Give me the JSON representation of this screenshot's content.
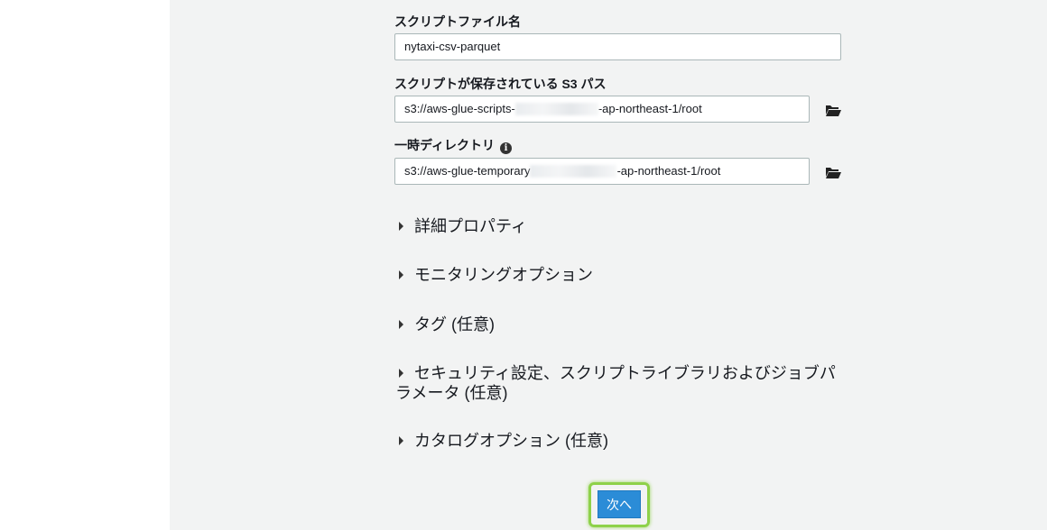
{
  "form": {
    "script_filename": {
      "label": "スクリプトファイル名",
      "value": "nytaxi-csv-parquet"
    },
    "script_s3_path": {
      "label": "スクリプトが保存されている S3 パス",
      "value_prefix": "s3://aws-glue-scripts-",
      "value_suffix": "-ap-northeast-1/root",
      "browse_icon": "folder-open-icon"
    },
    "temp_directory": {
      "label": "一時ディレクトリ",
      "info_icon": "info-icon",
      "value_prefix": "s3://aws-glue-temporary",
      "value_suffix": "-ap-northeast-1/root",
      "browse_icon": "folder-open-icon"
    }
  },
  "sections": [
    {
      "label": "詳細プロパティ"
    },
    {
      "label": "モニタリングオプション"
    },
    {
      "label": "タグ (任意)"
    },
    {
      "label": "セキュリティ設定、スクリプトライブラリおよびジョブパラメータ (任意)"
    },
    {
      "label": "カタログオプション (任意)"
    }
  ],
  "next_button": {
    "label": "次へ"
  },
  "colors": {
    "panel_bg": "#f2f3f3",
    "button_blue": "#2b8cd7",
    "highlight_green": "#8ed14a"
  }
}
